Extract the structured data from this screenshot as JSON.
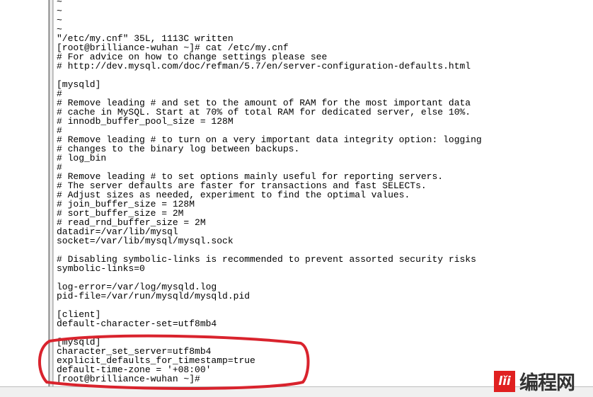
{
  "terminal": {
    "lines": [
      "~",
      "~",
      "~",
      "~",
      "\"/etc/my.cnf\" 35L, 1113C written",
      "[root@brilliance-wuhan ~]# cat /etc/my.cnf",
      "# For advice on how to change settings please see",
      "# http://dev.mysql.com/doc/refman/5.7/en/server-configuration-defaults.html",
      "",
      "[mysqld]",
      "#",
      "# Remove leading # and set to the amount of RAM for the most important data",
      "# cache in MySQL. Start at 70% of total RAM for dedicated server, else 10%.",
      "# innodb_buffer_pool_size = 128M",
      "#",
      "# Remove leading # to turn on a very important data integrity option: logging",
      "# changes to the binary log between backups.",
      "# log_bin",
      "#",
      "# Remove leading # to set options mainly useful for reporting servers.",
      "# The server defaults are faster for transactions and fast SELECTs.",
      "# Adjust sizes as needed, experiment to find the optimal values.",
      "# join_buffer_size = 128M",
      "# sort_buffer_size = 2M",
      "# read_rnd_buffer_size = 2M",
      "datadir=/var/lib/mysql",
      "socket=/var/lib/mysql/mysql.sock",
      "",
      "# Disabling symbolic-links is recommended to prevent assorted security risks",
      "symbolic-links=0",
      "",
      "log-error=/var/log/mysqld.log",
      "pid-file=/var/run/mysqld/mysqld.pid",
      "",
      "[client]",
      "default-character-set=utf8mb4",
      "",
      "[mysqld]",
      "character_set_server=utf8mb4",
      "explicit_defaults_for_timestamp=true",
      "default-time-zone = '+08:00'",
      "[root@brilliance-wuhan ~]#"
    ]
  },
  "annotation": {
    "color": "#d9232d"
  },
  "watermark": {
    "badge": "/<i",
    "text": "编程网"
  }
}
